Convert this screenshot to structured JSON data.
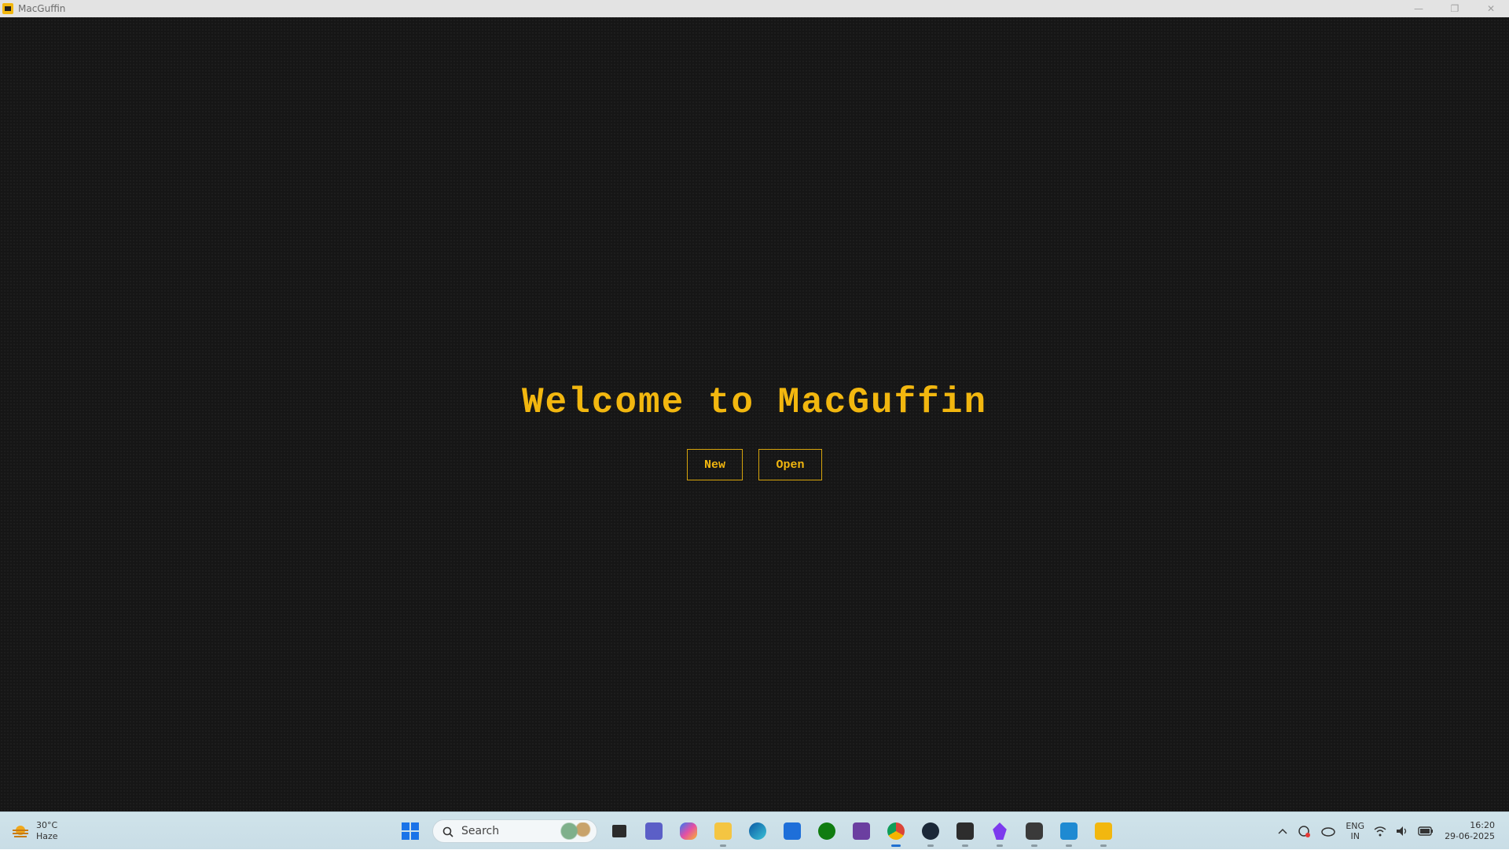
{
  "window": {
    "title": "MacGuffin",
    "minimize": "—",
    "maximize": "❐",
    "close": "✕"
  },
  "main": {
    "heading": "Welcome to MacGuffin",
    "new_label": "New",
    "open_label": "Open"
  },
  "colors": {
    "accent": "#f2b70f",
    "background": "#161616"
  },
  "taskbar": {
    "weather": {
      "temp": "30°C",
      "condition": "Haze"
    },
    "search_label": "Search",
    "apps": [
      "start-icon",
      "search",
      "task-view-icon",
      "teams-icon",
      "copilot-icon",
      "file-explorer-icon",
      "edge-icon",
      "store-icon",
      "xbox-icon",
      "app-icon",
      "chrome-icon",
      "steam-icon",
      "terminal-icon",
      "obsidian-icon",
      "notepad-icon",
      "vscode-icon",
      "macguffin-icon"
    ],
    "language": {
      "lang": "ENG",
      "region": "IN"
    },
    "time": "16:20",
    "date": "29-06-2025"
  }
}
